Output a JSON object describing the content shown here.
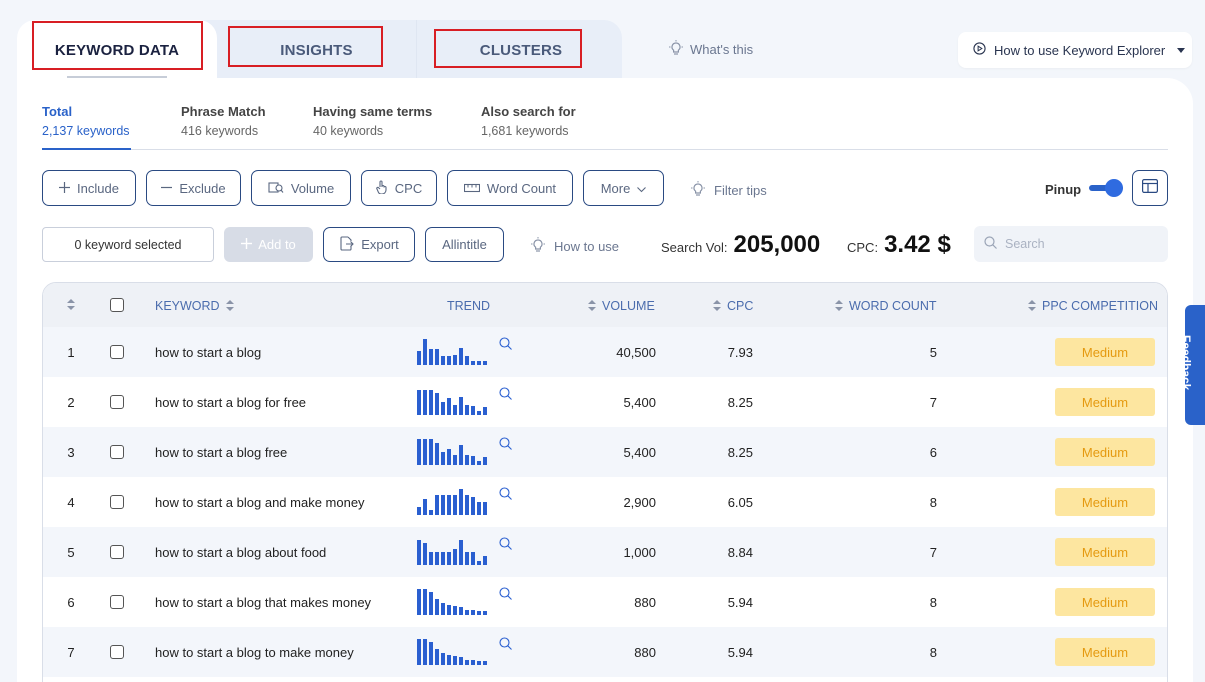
{
  "tabs": [
    {
      "label": "KEYWORD DATA"
    },
    {
      "label": "INSIGHTS"
    },
    {
      "label": "CLUSTERS"
    }
  ],
  "whats_this": "What's this",
  "how_to_use_explorer": "How to use Keyword Explorer",
  "subtabs": [
    {
      "title": "Total",
      "count": "2,137 keywords"
    },
    {
      "title": "Phrase Match",
      "count": "416 keywords"
    },
    {
      "title": "Having same terms",
      "count": "40 keywords"
    },
    {
      "title": "Also search for",
      "count": "1,681 keywords"
    }
  ],
  "filters": {
    "include": "Include",
    "exclude": "Exclude",
    "volume": "Volume",
    "cpc": "CPC",
    "word_count": "Word Count",
    "more": "More",
    "filter_tips": "Filter tips",
    "pinup": "Pinup"
  },
  "actions": {
    "selected": "0 keyword selected",
    "add_to": "Add to",
    "export": "Export",
    "allintitle": "Allintitle",
    "how_to_use": "How to use",
    "search_vol_label": "Search Vol:",
    "search_vol_value": "205,000",
    "cpc_label": "CPC:",
    "cpc_value": "3.42 $",
    "search_placeholder": "Search"
  },
  "table": {
    "headers": {
      "keyword": "KEYWORD",
      "trend": "TREND",
      "volume": "VOLUME",
      "cpc": "CPC",
      "word_count": "WORD COUNT",
      "ppc_competition": "PPC COMPETITION"
    },
    "rows": [
      {
        "n": "1",
        "keyword": "how to start a blog",
        "volume": "40,500",
        "cpc": "7.93",
        "wc": "5",
        "comp": "Medium",
        "trend": [
          0.55,
          1.0,
          0.6,
          0.6,
          0.35,
          0.35,
          0.4,
          0.65,
          0.35,
          0.15,
          0.15,
          0.15
        ]
      },
      {
        "n": "2",
        "keyword": "how to start a blog for free",
        "volume": "5,400",
        "cpc": "8.25",
        "wc": "7",
        "comp": "Medium",
        "trend": [
          0.95,
          0.95,
          0.95,
          0.85,
          0.5,
          0.65,
          0.4,
          0.7,
          0.4,
          0.35,
          0.15,
          0.3
        ]
      },
      {
        "n": "3",
        "keyword": "how to start a blog free",
        "volume": "5,400",
        "cpc": "8.25",
        "wc": "6",
        "comp": "Medium",
        "trend": [
          1.0,
          1.0,
          1.0,
          0.85,
          0.5,
          0.6,
          0.4,
          0.75,
          0.4,
          0.35,
          0.15,
          0.3
        ]
      },
      {
        "n": "4",
        "keyword": "how to start a blog and make money",
        "volume": "2,900",
        "cpc": "6.05",
        "wc": "8",
        "comp": "Medium",
        "trend": [
          0.3,
          0.6,
          0.2,
          0.75,
          0.75,
          0.75,
          0.75,
          1.0,
          0.75,
          0.7,
          0.5,
          0.5
        ]
      },
      {
        "n": "5",
        "keyword": "how to start a blog about food",
        "volume": "1,000",
        "cpc": "8.84",
        "wc": "7",
        "comp": "Medium",
        "trend": [
          0.95,
          0.85,
          0.5,
          0.5,
          0.5,
          0.5,
          0.6,
          0.95,
          0.5,
          0.5,
          0.15,
          0.35
        ]
      },
      {
        "n": "6",
        "keyword": "how to start a blog that makes money",
        "volume": "880",
        "cpc": "5.94",
        "wc": "8",
        "comp": "Medium",
        "trend": [
          1.0,
          1.0,
          0.9,
          0.6,
          0.45,
          0.4,
          0.35,
          0.3,
          0.2,
          0.2,
          0.15,
          0.15
        ]
      },
      {
        "n": "7",
        "keyword": "how to start a blog to make money",
        "volume": "880",
        "cpc": "5.94",
        "wc": "8",
        "comp": "Medium",
        "trend": [
          1.0,
          1.0,
          0.9,
          0.6,
          0.45,
          0.4,
          0.35,
          0.3,
          0.2,
          0.2,
          0.15,
          0.15
        ]
      }
    ]
  },
  "feedback": "Feedback",
  "colors": {
    "accent": "#2a62c9",
    "badge_bg": "#fde6a0",
    "badge_text": "#e59a10",
    "highlight_box": "#d81e24"
  }
}
